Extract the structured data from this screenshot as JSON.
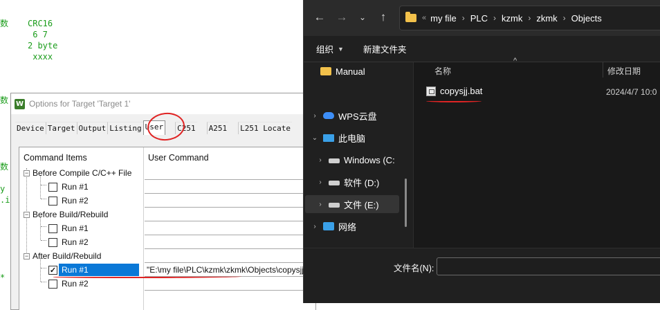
{
  "editor": {
    "line1_char": "数",
    "code_lines": [
      "CRC16",
      " 6 7",
      "2 byte",
      " xxxx"
    ],
    "left_fragments": [
      "数",
      "数",
      "y",
      ".i",
      "*"
    ]
  },
  "options_dialog": {
    "title": "Options for Target 'Target 1'",
    "tabs": [
      "Device",
      "Target",
      "Output",
      "Listing",
      "User",
      "C251",
      "A251",
      "L251 Locate"
    ],
    "active_tab": "User",
    "columns": {
      "left": "Command Items",
      "right": "User Command"
    },
    "groups": [
      {
        "label": "Before Compile C/C++ File",
        "runs": [
          {
            "label": "Run #1",
            "checked": false,
            "command": ""
          },
          {
            "label": "Run #2",
            "checked": false,
            "command": ""
          }
        ]
      },
      {
        "label": "Before Build/Rebuild",
        "runs": [
          {
            "label": "Run #1",
            "checked": false,
            "command": ""
          },
          {
            "label": "Run #2",
            "checked": false,
            "command": ""
          }
        ]
      },
      {
        "label": "After Build/Rebuild",
        "runs": [
          {
            "label": "Run #1",
            "checked": true,
            "command": "\"E:\\my file\\PLC\\kzmk\\zkmk\\Objects\\copysjj.bat\""
          },
          {
            "label": "Run #2",
            "checked": false,
            "command": ""
          }
        ]
      }
    ]
  },
  "file_dialog": {
    "breadcrumb": [
      "my file",
      "PLC",
      "kzmk",
      "zkmk",
      "Objects"
    ],
    "breadcrumb_prefix": "«",
    "toolbar": {
      "organize": "组织",
      "new_folder": "新建文件夹"
    },
    "nav_items": [
      {
        "label": "Manual",
        "icon": "folder-icon",
        "chevron": false
      },
      {
        "label": "WPS云盘",
        "icon": "cloud-icon",
        "chevron": true
      },
      {
        "label": "此电脑",
        "icon": "computer-icon",
        "chevron": true,
        "expanded": true
      },
      {
        "label": "Windows  (C:",
        "icon": "drive-icon",
        "chevron": true
      },
      {
        "label": "软件 (D:)",
        "icon": "drive-icon",
        "chevron": true
      },
      {
        "label": "文件 (E:)",
        "icon": "drive-icon",
        "chevron": true,
        "selected": true
      },
      {
        "label": "网络",
        "icon": "network-icon",
        "chevron": true
      }
    ],
    "columns": {
      "name": "名称",
      "modified": "修改日期"
    },
    "files": [
      {
        "name": "copysjj.bat",
        "modified": "2024/4/7 10:0"
      }
    ],
    "filename_label": "文件名(N):",
    "filename_value": ""
  }
}
